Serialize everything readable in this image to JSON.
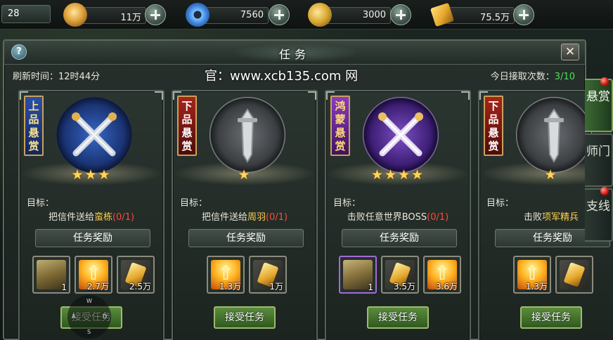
{
  "topbar": {
    "level": "28",
    "resources": [
      {
        "icon": "ingot-icon",
        "value": "11万"
      },
      {
        "icon": "jade-icon",
        "value": "7560"
      },
      {
        "icon": "coin-icon",
        "value": "3000"
      },
      {
        "icon": "ticket-icon",
        "value": "75.5万"
      }
    ]
  },
  "panel": {
    "title": "任务",
    "help": "?",
    "close": "✕",
    "refresh_text": "刷新时间：12时44分",
    "watermark": "官：www.xcb135.com 网",
    "daily_label": "今日接取次数：",
    "daily_count": "3/10"
  },
  "cards": [
    {
      "grade": "上品悬赏",
      "stars": "★★★",
      "goal_label": "目标：",
      "goal_prefix": "把信件送给",
      "goal_target": "蛮栋",
      "goal_progress": "(0/1)",
      "reward_label": "任务奖励",
      "items": [
        {
          "icon": "treasure-chest-icon",
          "qty": "1"
        },
        {
          "icon": "exp-arrow-icon",
          "qty": "2.7万"
        },
        {
          "icon": "gold-ticket-icon",
          "qty": "2.5万"
        }
      ],
      "accept": "接受任务"
    },
    {
      "grade": "下品悬赏",
      "stars": "★",
      "goal_label": "目标：",
      "goal_prefix": "把信件送给",
      "goal_target": "周羽",
      "goal_progress": "(0/1)",
      "reward_label": "任务奖励",
      "items": [
        {
          "icon": "exp-arrow-icon",
          "qty": "1.3万"
        },
        {
          "icon": "gold-ticket-icon",
          "qty": "1万"
        }
      ],
      "accept": "接受任务"
    },
    {
      "grade": "鸿蒙悬赏",
      "stars": "★★★★",
      "goal_label": "目标：",
      "goal_prefix": "击败任意世界BOSS",
      "goal_target": "",
      "goal_progress": "(0/1)",
      "reward_label": "任务奖励",
      "items": [
        {
          "icon": "treasure-chest-icon",
          "qty": "1"
        },
        {
          "icon": "gold-ticket-icon",
          "qty": "3.5万"
        },
        {
          "icon": "exp-arrow-icon",
          "qty": "3.6万"
        }
      ],
      "accept": "接受任务"
    },
    {
      "grade": "下品悬赏",
      "stars": "★",
      "goal_label": "目标：",
      "goal_prefix": "击败",
      "goal_target": "项军精兵",
      "goal_progress": "",
      "reward_label": "任务奖励",
      "items": [
        {
          "icon": "exp-arrow-icon",
          "qty": "1.3万"
        },
        {
          "icon": "gold-ticket-icon",
          "qty": ""
        }
      ],
      "accept": "接受任务"
    }
  ],
  "side_tabs": [
    {
      "label": "悬赏",
      "active": true
    },
    {
      "label": "师门",
      "active": false
    },
    {
      "label": "支线",
      "active": false
    }
  ],
  "compass": {
    "n": "W",
    "w": "A",
    "e": "D",
    "s": "S"
  },
  "colors": {
    "accent_green": "#4fdc5a",
    "highlight_yellow": "#ffd24d",
    "progress_red": "#ff4a3a"
  }
}
